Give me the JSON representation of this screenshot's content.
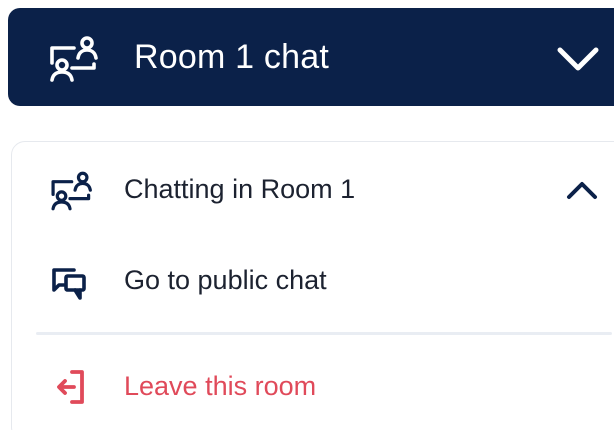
{
  "header": {
    "title": "Room 1 chat",
    "icon": "room-chat-icon",
    "toggle_icon": "chevron-down-icon",
    "background": "#0b2149",
    "text_color": "#ffffff"
  },
  "menu": {
    "items": [
      {
        "label": "Chatting in Room 1",
        "icon": "room-chat-icon",
        "trailing_icon": "chevron-up-icon"
      },
      {
        "label": "Go to public chat",
        "icon": "chat-bubbles-icon"
      },
      {
        "label": "Leave this room",
        "icon": "exit-icon",
        "color": "#e04a5a"
      }
    ]
  }
}
